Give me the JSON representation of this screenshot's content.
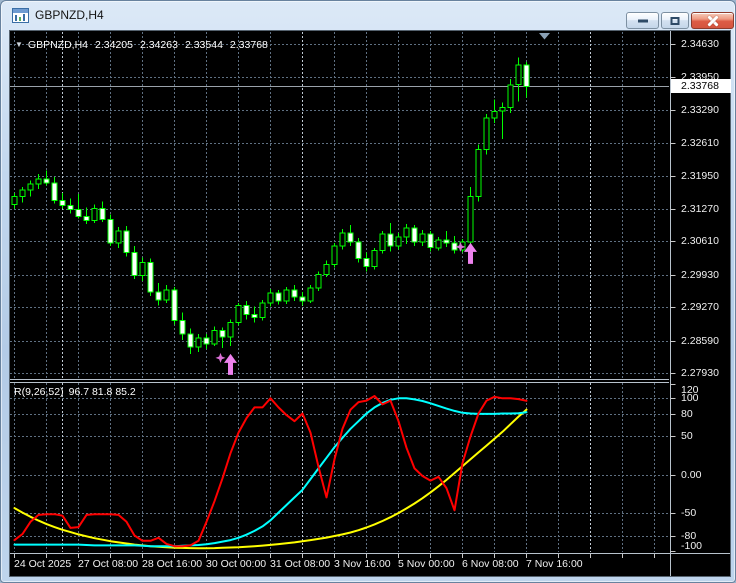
{
  "window": {
    "title": "GBPNZD,H4"
  },
  "header": {
    "dropdown_icon": "▼",
    "symbol": "GBPNZD,H4",
    "open": "2.34205",
    "high": "2.34263",
    "low": "2.33544",
    "close": "2.33768"
  },
  "price_axis": {
    "labels": [
      "2.34630",
      "2.33950",
      "2.33290",
      "2.32610",
      "2.31950",
      "2.31270",
      "2.30610",
      "2.29930",
      "2.29270",
      "2.28590",
      "2.27930"
    ],
    "current": "2.33768"
  },
  "indicator_axis": {
    "labels": [
      "120",
      "100",
      "80",
      "50",
      "0.00",
      "-50",
      "-80",
      "-100"
    ]
  },
  "time_axis": {
    "labels": [
      "24 Oct 2025",
      "27 Oct 08:00",
      "28 Oct 16:00",
      "30 Oct 00:00",
      "31 Oct 08:00",
      "3 Nov 16:00",
      "5 Nov 00:00",
      "6 Nov 08:00",
      "7 Nov 16:00"
    ]
  },
  "colors": {
    "background": "#000000",
    "chart_text": "#f0f0f0",
    "grid": "#5f7082",
    "week_separator": "#c0cad4",
    "candle_outline": "#00ff00",
    "bull_body": "#000000",
    "bear_body": "#ffffff",
    "bid_line": "#9aa2aa",
    "pane_border": "#b8c2cc",
    "frame": "#55626e",
    "arrow": "#ee82ee",
    "star": "#da70d6",
    "shift_marker": "#8aa0b4",
    "line_fast": "#ff0000",
    "line_mid": "#00ffff",
    "line_slow": "#ffff00"
  },
  "chart_data": {
    "type": "candlestick",
    "symbol": "GBPNZD",
    "period": "H4",
    "ohlc_current": {
      "open": 2.34205,
      "high": 2.34263,
      "low": 2.33544,
      "close": 2.33768
    },
    "bid_price": 2.33768,
    "price_axis_values": [
      2.3463,
      2.3395,
      2.3329,
      2.3261,
      2.3195,
      2.3127,
      2.3061,
      2.2993,
      2.2927,
      2.2859,
      2.2793
    ],
    "candles_per_gridline": 4,
    "labels_every_gridlines": 2,
    "week_separator_candles": [
      6,
      36,
      72
    ],
    "candles": [
      [
        2.3136,
        2.316,
        2.3128,
        2.3152
      ],
      [
        2.3152,
        2.3172,
        2.314,
        2.3166
      ],
      [
        2.3166,
        2.3185,
        2.3152,
        2.3178
      ],
      [
        2.3178,
        2.3198,
        2.3168,
        2.3188
      ],
      [
        2.3188,
        2.3205,
        2.3175,
        2.318
      ],
      [
        2.318,
        2.3192,
        2.3138,
        2.3144
      ],
      [
        2.3144,
        2.316,
        2.3128,
        2.3134
      ],
      [
        2.3134,
        2.3148,
        2.3118,
        2.3126
      ],
      [
        2.3126,
        2.3158,
        2.3108,
        2.3112
      ],
      [
        2.3112,
        2.313,
        2.3096,
        2.3104
      ],
      [
        2.3104,
        2.3136,
        2.3098,
        2.3128
      ],
      [
        2.3128,
        2.3142,
        2.31,
        2.3106
      ],
      [
        2.3106,
        2.3116,
        2.3052,
        2.3058
      ],
      [
        2.3058,
        2.309,
        2.3048,
        2.3082
      ],
      [
        2.3082,
        2.3092,
        2.303,
        2.3038
      ],
      [
        2.3038,
        2.3052,
        2.2984,
        2.2992
      ],
      [
        2.2992,
        2.3028,
        2.298,
        2.3018
      ],
      [
        2.3018,
        2.3026,
        2.295,
        2.2958
      ],
      [
        2.2958,
        2.2976,
        2.293,
        2.2942
      ],
      [
        2.2942,
        2.2972,
        2.2936,
        2.2962
      ],
      [
        2.2962,
        2.2968,
        2.2892,
        2.29
      ],
      [
        2.29,
        2.2916,
        2.286,
        2.2872
      ],
      [
        2.2872,
        2.2884,
        2.2832,
        2.2846
      ],
      [
        2.2846,
        2.2872,
        2.2836,
        2.2864
      ],
      [
        2.2864,
        2.2872,
        2.2842,
        2.2852
      ],
      [
        2.2852,
        2.2888,
        2.2848,
        2.288
      ],
      [
        2.288,
        2.2886,
        2.2844,
        2.2866
      ],
      [
        2.2866,
        2.2902,
        2.2848,
        2.2896
      ],
      [
        2.2896,
        2.2936,
        2.289,
        2.293
      ],
      [
        2.293,
        2.294,
        2.2902,
        2.2912
      ],
      [
        2.2912,
        2.2928,
        2.2896,
        2.2906
      ],
      [
        2.2906,
        2.2942,
        2.29,
        2.2936
      ],
      [
        2.2936,
        2.2964,
        2.2928,
        2.2956
      ],
      [
        2.2956,
        2.2962,
        2.2932,
        2.294
      ],
      [
        2.294,
        2.2968,
        2.2934,
        2.2962
      ],
      [
        2.2962,
        2.2972,
        2.294,
        2.2948
      ],
      [
        2.2948,
        2.2958,
        2.293,
        2.294
      ],
      [
        2.294,
        2.2972,
        2.2936,
        2.2966
      ],
      [
        2.2966,
        2.3,
        2.296,
        2.2994
      ],
      [
        2.2994,
        2.3022,
        2.2988,
        2.3014
      ],
      [
        2.3014,
        2.3058,
        2.3008,
        2.3052
      ],
      [
        2.3052,
        2.3086,
        2.3044,
        2.3078
      ],
      [
        2.3078,
        2.3094,
        2.3052,
        2.306
      ],
      [
        2.306,
        2.3068,
        2.3018,
        2.3026
      ],
      [
        2.3026,
        2.3038,
        2.3,
        2.301
      ],
      [
        2.301,
        2.3048,
        2.3004,
        2.3042
      ],
      [
        2.3042,
        2.3082,
        2.3036,
        2.3076
      ],
      [
        2.3076,
        2.3098,
        2.304,
        2.3052
      ],
      [
        2.3052,
        2.3078,
        2.3044,
        2.307
      ],
      [
        2.307,
        2.3096,
        2.3056,
        2.3088
      ],
      [
        2.3088,
        2.3094,
        2.3052,
        2.306
      ],
      [
        2.306,
        2.3084,
        2.3052,
        2.3076
      ],
      [
        2.3076,
        2.3082,
        2.304,
        2.3048
      ],
      [
        2.3048,
        2.307,
        2.3042,
        2.3064
      ],
      [
        2.3064,
        2.3082,
        2.305,
        2.3058
      ],
      [
        2.3058,
        2.3072,
        2.3036,
        2.3044
      ],
      [
        2.3044,
        2.3066,
        2.3038,
        2.306
      ],
      [
        2.306,
        2.3172,
        2.3054,
        2.3152
      ],
      [
        2.3152,
        2.3258,
        2.3142,
        2.3248
      ],
      [
        2.3248,
        2.332,
        2.3238,
        2.3312
      ],
      [
        2.3312,
        2.335,
        2.3302,
        2.3326
      ],
      [
        2.3326,
        2.3344,
        2.327,
        2.3334
      ],
      [
        2.3334,
        2.3392,
        2.3322,
        2.338
      ],
      [
        2.338,
        2.3436,
        2.3346,
        2.342
      ],
      [
        2.34205,
        2.34263,
        2.33544,
        2.33768
      ]
    ],
    "arrows": [
      {
        "candle": 27,
        "price": 2.2832,
        "type": "up"
      },
      {
        "candle": 57,
        "price": 2.3058,
        "type": "up"
      }
    ],
    "indicator": {
      "label": "R(9,26,52)",
      "values_text": "96.7 81.8 85.2",
      "current_values": [
        96.7,
        81.8,
        85.2
      ],
      "axis_values": [
        120,
        100,
        80,
        50,
        0,
        -50,
        -80,
        -100
      ],
      "gridline_values": [
        100,
        80,
        50,
        0,
        -50,
        -80
      ],
      "range": [
        -101,
        121
      ],
      "series": [
        {
          "name": "fast",
          "color_key": "line_fast",
          "values": [
            -86,
            -78,
            -62,
            -53,
            -52,
            -52,
            -54,
            -70,
            -69,
            -53,
            -52,
            -52,
            -52,
            -53,
            -62,
            -80,
            -87,
            -87,
            -83,
            -91,
            -94,
            -94,
            -93,
            -87,
            -62,
            -35,
            -5,
            28,
            55,
            74,
            88,
            88,
            100,
            88,
            78,
            70,
            80,
            55,
            10,
            -30,
            20,
            60,
            85,
            95,
            97,
            103,
            92,
            97,
            70,
            35,
            8,
            -2,
            -8,
            -3,
            -18,
            -47,
            15,
            50,
            80,
            97,
            102,
            100,
            100,
            99,
            96.7
          ]
        },
        {
          "name": "mid",
          "color_key": "line_mid",
          "values": [
            -92,
            -92,
            -92,
            -92,
            -92,
            -92,
            -92,
            -92,
            -92,
            -92.5,
            -93,
            -93,
            -93,
            -93,
            -93,
            -93,
            -93.5,
            -94,
            -94,
            -94,
            -94,
            -93.5,
            -93,
            -92.5,
            -91.5,
            -90,
            -88,
            -86,
            -83,
            -79,
            -74,
            -68,
            -60,
            -50,
            -40,
            -30,
            -20,
            -6,
            8,
            22,
            36,
            48,
            60,
            70,
            80,
            88,
            94,
            98,
            100,
            100,
            98.5,
            96.5,
            93.5,
            90,
            86.5,
            83.5,
            81,
            80,
            79.5,
            79.5,
            79.5,
            80,
            80,
            80.5,
            81.8
          ]
        },
        {
          "name": "slow",
          "color_key": "line_slow",
          "values": [
            -44,
            -50,
            -55.5,
            -60.5,
            -65,
            -69,
            -72.5,
            -75.5,
            -78.5,
            -81,
            -83.5,
            -85.5,
            -87.5,
            -89,
            -90.5,
            -92,
            -93,
            -94,
            -94.8,
            -95.5,
            -96,
            -96.3,
            -96.5,
            -96.6,
            -96.6,
            -96.5,
            -96.2,
            -95.8,
            -95.3,
            -94.7,
            -94,
            -93.2,
            -92.3,
            -91.3,
            -90.2,
            -89,
            -87.6,
            -86.1,
            -84.5,
            -82.7,
            -80.7,
            -78.5,
            -76,
            -73,
            -69.5,
            -65.5,
            -61,
            -56,
            -50.5,
            -44.5,
            -38,
            -31,
            -23.5,
            -15.5,
            -7,
            2,
            11,
            20,
            29,
            38,
            47,
            56,
            66,
            76,
            85.2
          ]
        }
      ]
    }
  }
}
